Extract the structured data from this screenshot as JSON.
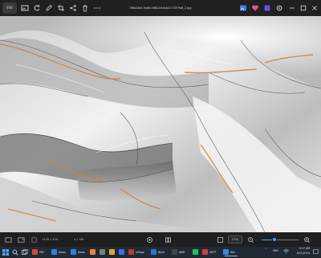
{
  "app": {
    "badge": "EVE"
  },
  "title": {
    "filename": "0f6a24dc-9ab6-4662-b5af-b2c172f7fad_2.jpg"
  },
  "toolbar": {
    "icons": [
      "image-icon",
      "rotate-icon",
      "edit-icon",
      "crop-icon",
      "share-icon",
      "delete-icon",
      "more-icon"
    ],
    "right_icons": [
      "gallery-icon",
      "heart-icon",
      "info-icon",
      "settings-icon"
    ]
  },
  "statusbar": {
    "file_size_label": "4.1 MB",
    "dimensions_label": "1456 x 816",
    "zoom_value": "17%",
    "zoom_fraction": 0.35
  },
  "taskbar": {
    "items": [
      {
        "label": "PDF",
        "color": "#d9453b"
      },
      {
        "label": "Down",
        "color": "#2f7de1"
      },
      {
        "label": "Down",
        "color": "#2f7de1"
      },
      {
        "label": "",
        "color": "#e8833a"
      },
      {
        "label": "",
        "color": "#7b7b7b"
      },
      {
        "label": "",
        "color": "#e4a829"
      },
      {
        "label": "",
        "color": "#3d6fe0"
      },
      {
        "label": "InPage",
        "color": "#c4372f"
      },
      {
        "label": "Wind",
        "color": "#2a6fdb"
      },
      {
        "label": "AMD",
        "color": "#444"
      },
      {
        "label": "",
        "color": "#1fbf5a"
      },
      {
        "label": "GETT",
        "color": "#cf3d3d"
      },
      {
        "label": "Win",
        "color": "#3a86e3"
      }
    ],
    "tray": {
      "language": "ENG",
      "time": "9:17 AM",
      "date": "5/21/2024"
    }
  },
  "colors": {
    "accent": "#4a9ff5",
    "chrome": "#202020",
    "taskbar": "#202a36"
  }
}
